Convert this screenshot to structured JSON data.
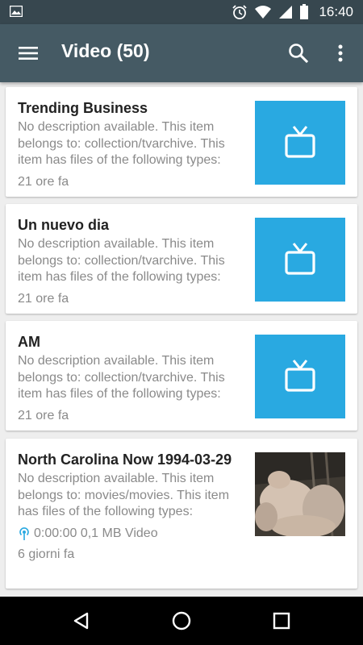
{
  "status_bar": {
    "time": "16:40"
  },
  "app_bar": {
    "title": "Video (50)"
  },
  "items": [
    {
      "title": "Trending Business",
      "description": "No description available. This item belongs to: collection/tvarchive. This item has files of the following types:",
      "time": "21 ore fa",
      "thumbnail": "tv-icon"
    },
    {
      "title": "Un nuevo dia",
      "description": "No description available. This item belongs to: collection/tvarchive. This item has files of the following types:",
      "time": "21 ore fa",
      "thumbnail": "tv-icon"
    },
    {
      "title": "AM",
      "description": "No description available. This item belongs to: collection/tvarchive. This item has files of the following types:",
      "time": "21 ore fa",
      "thumbnail": "tv-icon"
    },
    {
      "title": "North Carolina Now 1994-03-29",
      "description": "No description available. This item belongs to: movies/movies. This item has files of the following types:",
      "meta": "0:00:00 0,1 MB Video",
      "time": "6 giorni fa",
      "thumbnail": "photo"
    }
  ],
  "colors": {
    "status_bar": "#37474f",
    "app_bar": "#455a64",
    "tv_tile": "#29a9e1",
    "meta_icon": "#29a9e1"
  }
}
